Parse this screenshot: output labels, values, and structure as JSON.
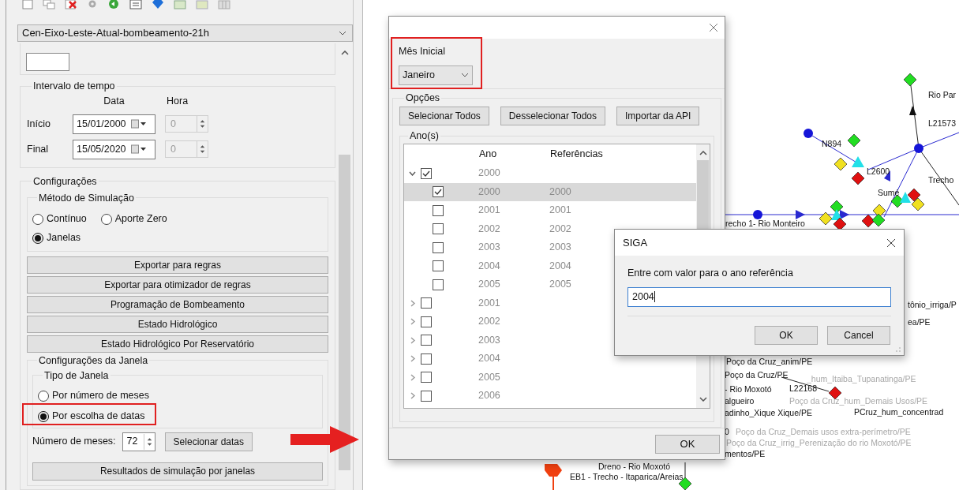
{
  "left_panel": {
    "scenario": "Cen-Eixo-Leste-Atual-bombeamento-21h",
    "interval": {
      "title": "Intervalo de tempo",
      "date_header": "Data",
      "hour_header": "Hora",
      "rows": [
        {
          "label": "Início",
          "date": "15/01/2000",
          "hour": "0",
          "disabled": true
        },
        {
          "label": "Final",
          "date": "15/05/2020",
          "hour": "0",
          "disabled": true
        }
      ]
    },
    "config": {
      "title": "Configurações",
      "method": {
        "title": "Método de Simulação",
        "options": [
          {
            "label": "Contínuo",
            "selected": false
          },
          {
            "label": "Aporte Zero",
            "selected": false
          },
          {
            "label": "Janelas",
            "selected": true
          }
        ]
      },
      "buttons": [
        "Exportar para regras",
        "Exportar para otimizador de regras",
        "Programação de Bombeamento",
        "Estado Hidrológico",
        "Estado Hidrológico Por Reservatório"
      ],
      "window_config": {
        "title": "Configurações da Janela",
        "window_type": {
          "title": "Tipo de Janela",
          "options": [
            {
              "label": "Por número de meses",
              "selected": false
            },
            {
              "label": "Por escolha de datas",
              "selected": true
            }
          ]
        },
        "months_label": "Número de meses:",
        "months": "72",
        "select_dates": "Selecionar datas",
        "results": "Resultados de simulação por janelas"
      }
    }
  },
  "dialog": {
    "month_label": "Mês Inicial",
    "month": "Janeiro",
    "options_title": "Opções",
    "buttons": [
      "Selecionar Todos",
      "Desselecionar Todos",
      "Importar da API"
    ],
    "years_title": "Ano(s)",
    "columns": [
      "Ano",
      "Referências"
    ],
    "rows": [
      {
        "year": "2000",
        "checked": true,
        "expanded": true,
        "children": [
          {
            "year": "2000",
            "reference": "2000",
            "checked": true,
            "selected": true
          },
          {
            "year": "2001",
            "reference": "2001",
            "checked": false,
            "selected": false
          },
          {
            "year": "2002",
            "reference": "2002",
            "checked": false,
            "selected": false
          },
          {
            "year": "2003",
            "reference": "2003",
            "checked": false,
            "selected": false
          },
          {
            "year": "2004",
            "reference": "2004",
            "checked": false,
            "selected": false
          },
          {
            "year": "2005",
            "reference": "2005",
            "checked": false,
            "selected": false
          }
        ]
      },
      {
        "year": "2001",
        "checked": false,
        "expanded": false
      },
      {
        "year": "2002",
        "checked": false,
        "expanded": false
      },
      {
        "year": "2003",
        "checked": false,
        "expanded": false
      },
      {
        "year": "2004",
        "checked": false,
        "expanded": false
      },
      {
        "year": "2005",
        "checked": false,
        "expanded": false
      },
      {
        "year": "2006",
        "checked": false,
        "expanded": false
      }
    ],
    "ok": "OK"
  },
  "prompt": {
    "title": "SIGA",
    "message": "Entre com valor para o ano referência",
    "value": "2004",
    "buttons": [
      "OK",
      "Cancel"
    ]
  },
  "map": {
    "labels": [
      {
        "text": "Rio Par",
        "faded": false
      },
      {
        "text": "L21573",
        "faded": false
      },
      {
        "text": "N894",
        "faded": false
      },
      {
        "text": "L2600",
        "faded": false
      },
      {
        "text": "Trecho",
        "faded": false
      },
      {
        "text": "Sumé",
        "faded": false
      },
      {
        "text": "recho 1- Rio Monteiro",
        "faded": false
      },
      {
        "text": "tônio_irriga/P",
        "faded": false
      },
      {
        "text": "ea/PE",
        "faded": false
      },
      {
        "text": "Poço da Cruz_anim/PE",
        "faded": false
      },
      {
        "text": "Poço da Cruz/PE",
        "faded": false
      },
      {
        "text": "_hum_Itaiba_Tupanatinga/PE",
        "faded": true
      },
      {
        "text": "L22168",
        "faded": false
      },
      {
        "text": "- Rio Moxotó",
        "faded": false
      },
      {
        "text": "algueiro",
        "faded": false
      },
      {
        "text": "Poço da Cruz_hum_Demais Usos/PE",
        "faded": true
      },
      {
        "text": "adinho_Xique Xique/PE",
        "faded": false
      },
      {
        "text": "PCruz_hum_concentrad",
        "faded": false
      },
      {
        "text": "0",
        "faded": false
      },
      {
        "text": "Poço da Cruz_Demais usos extra-perímetro/PE",
        "faded": true
      },
      {
        "text": "Poço da Cruz_irrig_Perenização do rio Moxotó/PE",
        "faded": true
      },
      {
        "text": "mentos/PE",
        "faded": false
      },
      {
        "text": "Dreno - Rio Moxotó",
        "faded": false
      },
      {
        "text": "EB1 - Trecho - Itaparica/Areias",
        "faded": false
      }
    ]
  }
}
